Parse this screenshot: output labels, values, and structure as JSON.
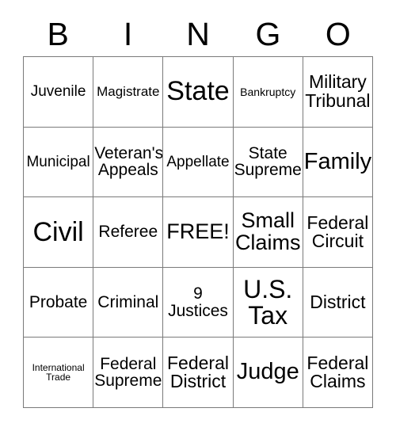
{
  "card": {
    "title": "BINGO",
    "header_letters": [
      "B",
      "I",
      "N",
      "G",
      "O"
    ],
    "grid_size": "5x5",
    "colors": {
      "background": "#ffffff",
      "text": "#000000",
      "grid_line": "#7a7a7a"
    },
    "free_space": "FREE!",
    "cells": [
      [
        {
          "text": "Juvenile",
          "size": "fs-lg"
        },
        {
          "text": "Magistrate",
          "size": "fs-md"
        },
        {
          "text": "State",
          "size": "fs-6xl"
        },
        {
          "text": "Bankruptcy",
          "size": "fs-sm"
        },
        {
          "text": "Military\nTribunal",
          "size": "fs-2xl"
        }
      ],
      [
        {
          "text": "Municipal",
          "size": "fs-lg"
        },
        {
          "text": "Veteran's\nAppeals",
          "size": "fs-xl"
        },
        {
          "text": "Appellate",
          "size": "fs-lg"
        },
        {
          "text": "State\nSupreme",
          "size": "fs-xl"
        },
        {
          "text": "Family",
          "size": "fs-4xl"
        }
      ],
      [
        {
          "text": "Civil",
          "size": "fs-6xl"
        },
        {
          "text": "Referee",
          "size": "fs-xl"
        },
        {
          "text": "FREE!",
          "size": "fs-3xl"
        },
        {
          "text": "Small\nClaims",
          "size": "fs-3xl"
        },
        {
          "text": "Federal\nCircuit",
          "size": "fs-2xl"
        }
      ],
      [
        {
          "text": "Probate",
          "size": "fs-xl"
        },
        {
          "text": "Criminal",
          "size": "fs-xl"
        },
        {
          "text": "9\nJustices",
          "size": "fs-xl"
        },
        {
          "text": "U.S.\nTax",
          "size": "fs-5xl"
        },
        {
          "text": "District",
          "size": "fs-2xl"
        }
      ],
      [
        {
          "text": "International\nTrade",
          "size": "fs-xs"
        },
        {
          "text": "Federal\nSupreme",
          "size": "fs-xl"
        },
        {
          "text": "Federal\nDistrict",
          "size": "fs-2xl"
        },
        {
          "text": "Judge",
          "size": "fs-4xl"
        },
        {
          "text": "Federal\nClaims",
          "size": "fs-2xl"
        }
      ]
    ]
  }
}
